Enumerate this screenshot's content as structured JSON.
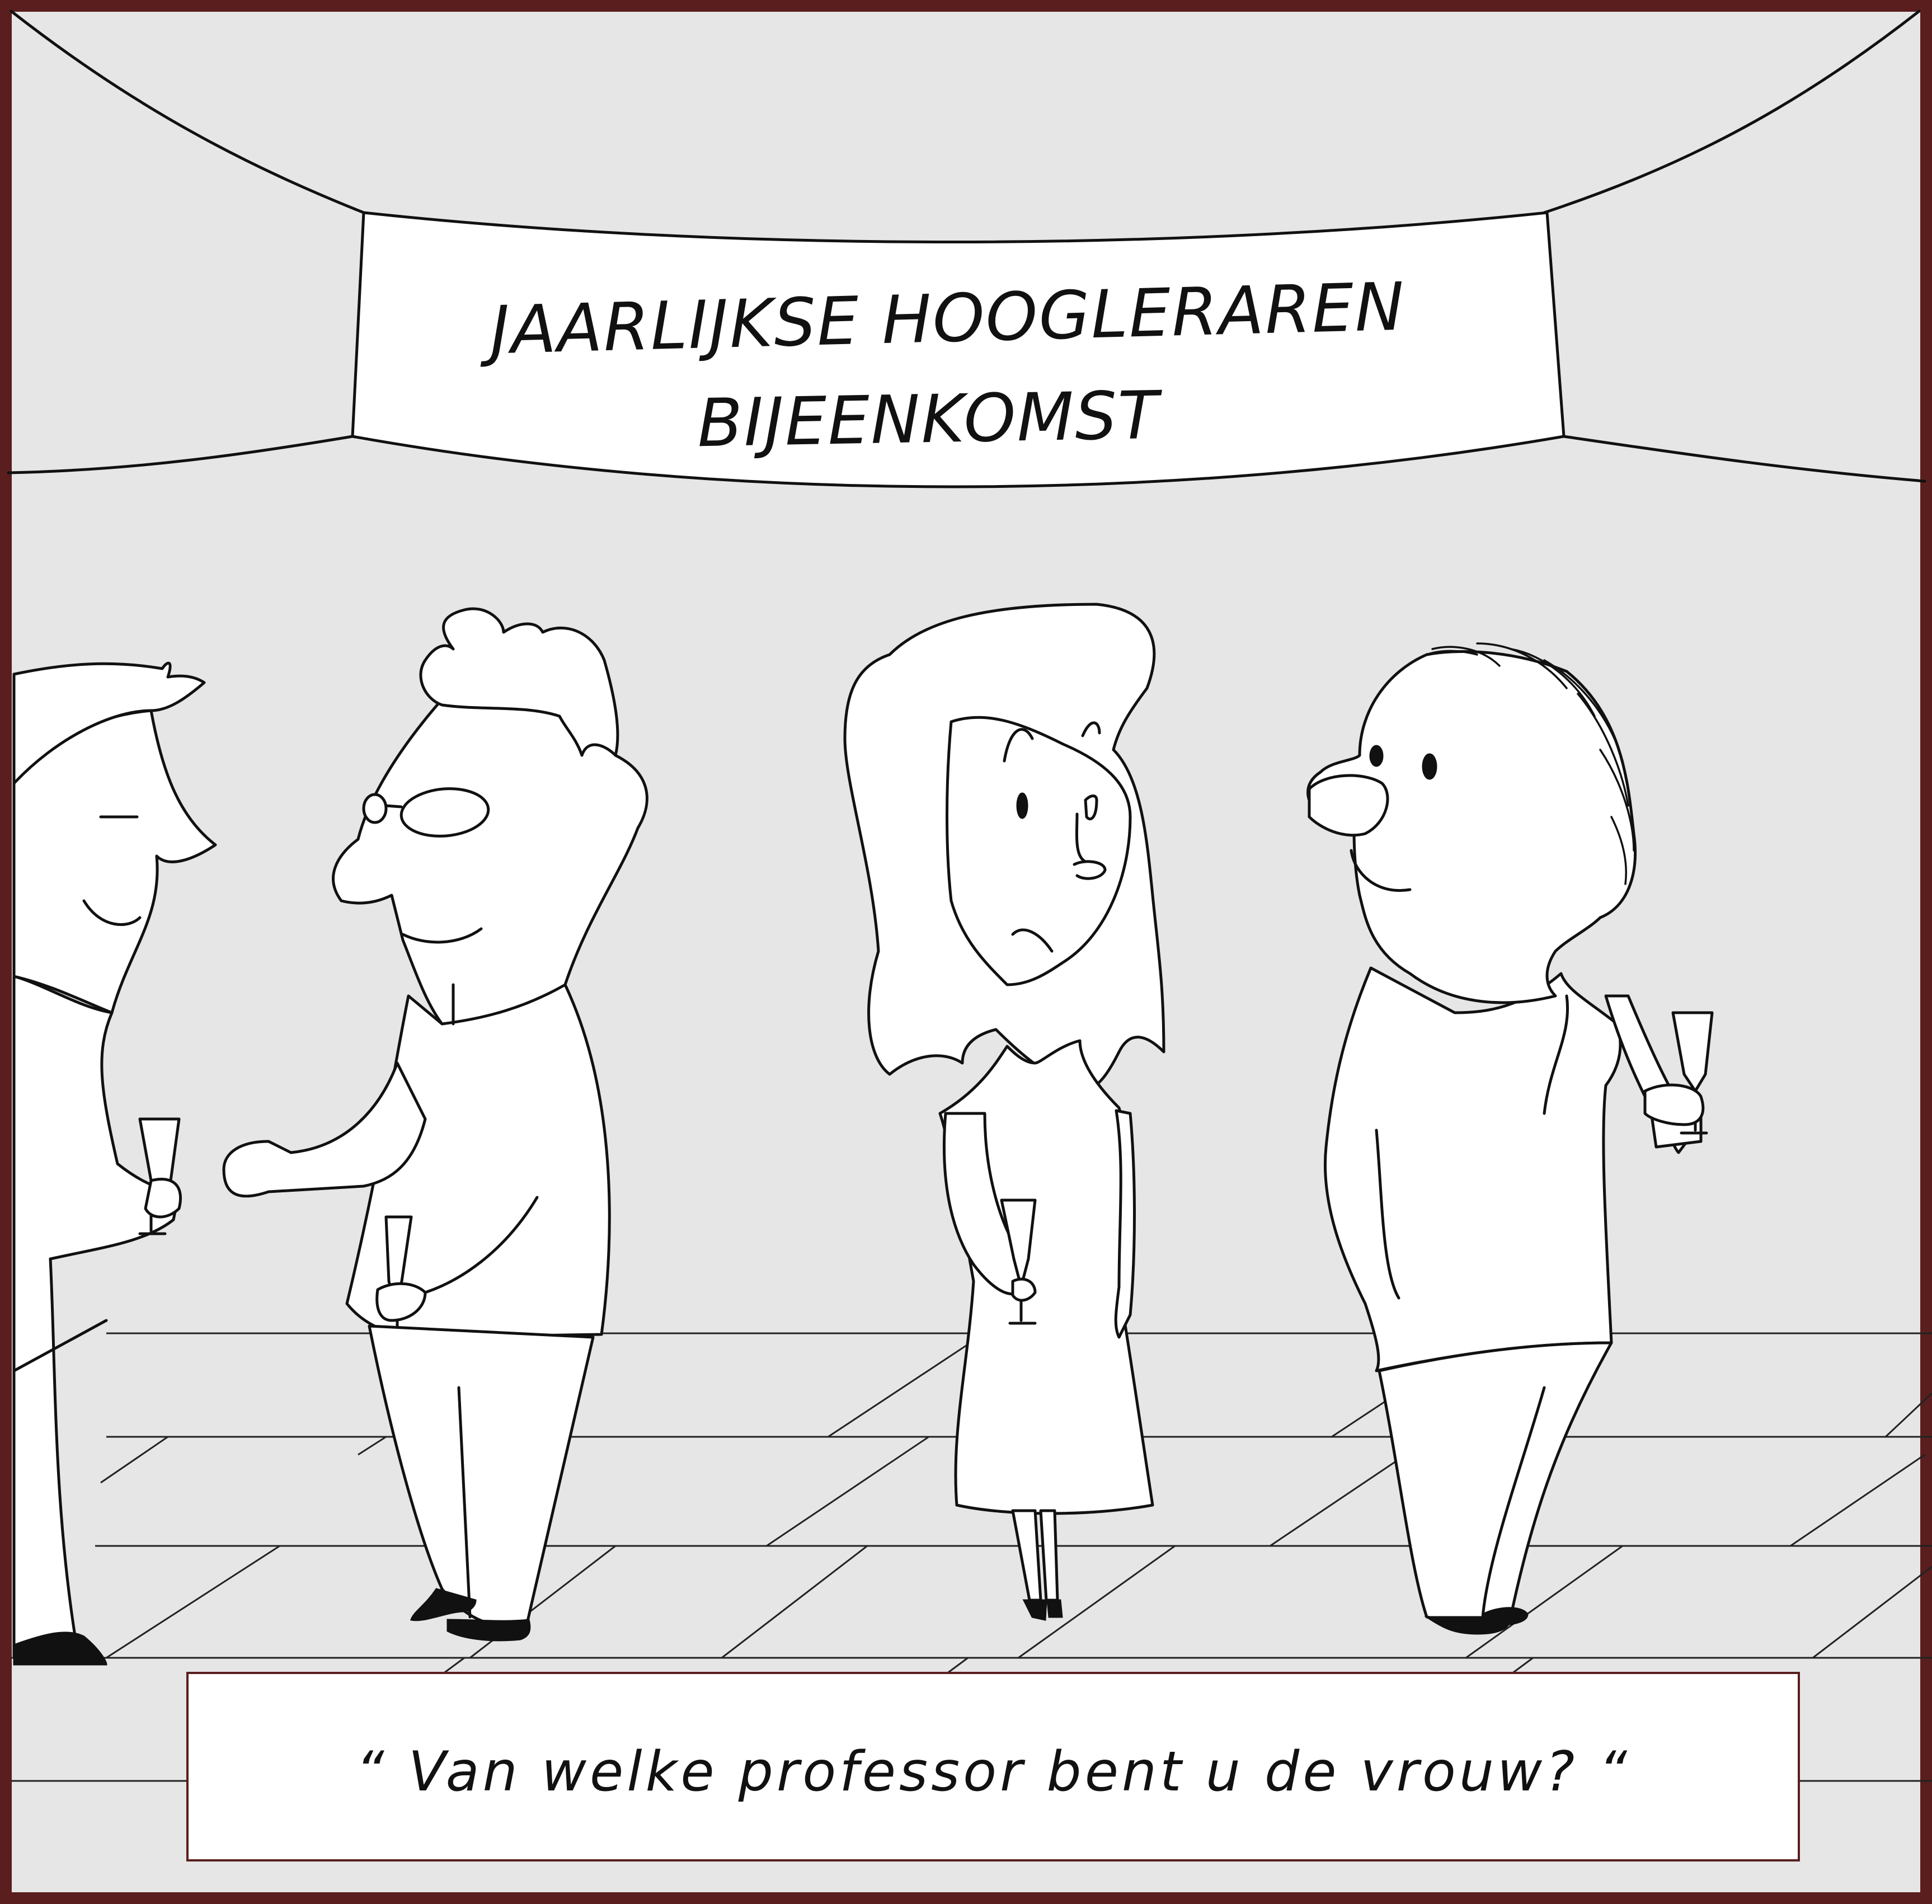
{
  "banner": {
    "line1": "JAARLIJKSE HOOGLERAREN",
    "line2": "BIJEENKOMST"
  },
  "caption": {
    "text": "“ Van welke professor bent u de vrouw? “"
  },
  "colors": {
    "frame": "#5a1e1e",
    "background": "#e6e6e6",
    "ink": "#111111",
    "panel_fill": "#ffffff"
  }
}
